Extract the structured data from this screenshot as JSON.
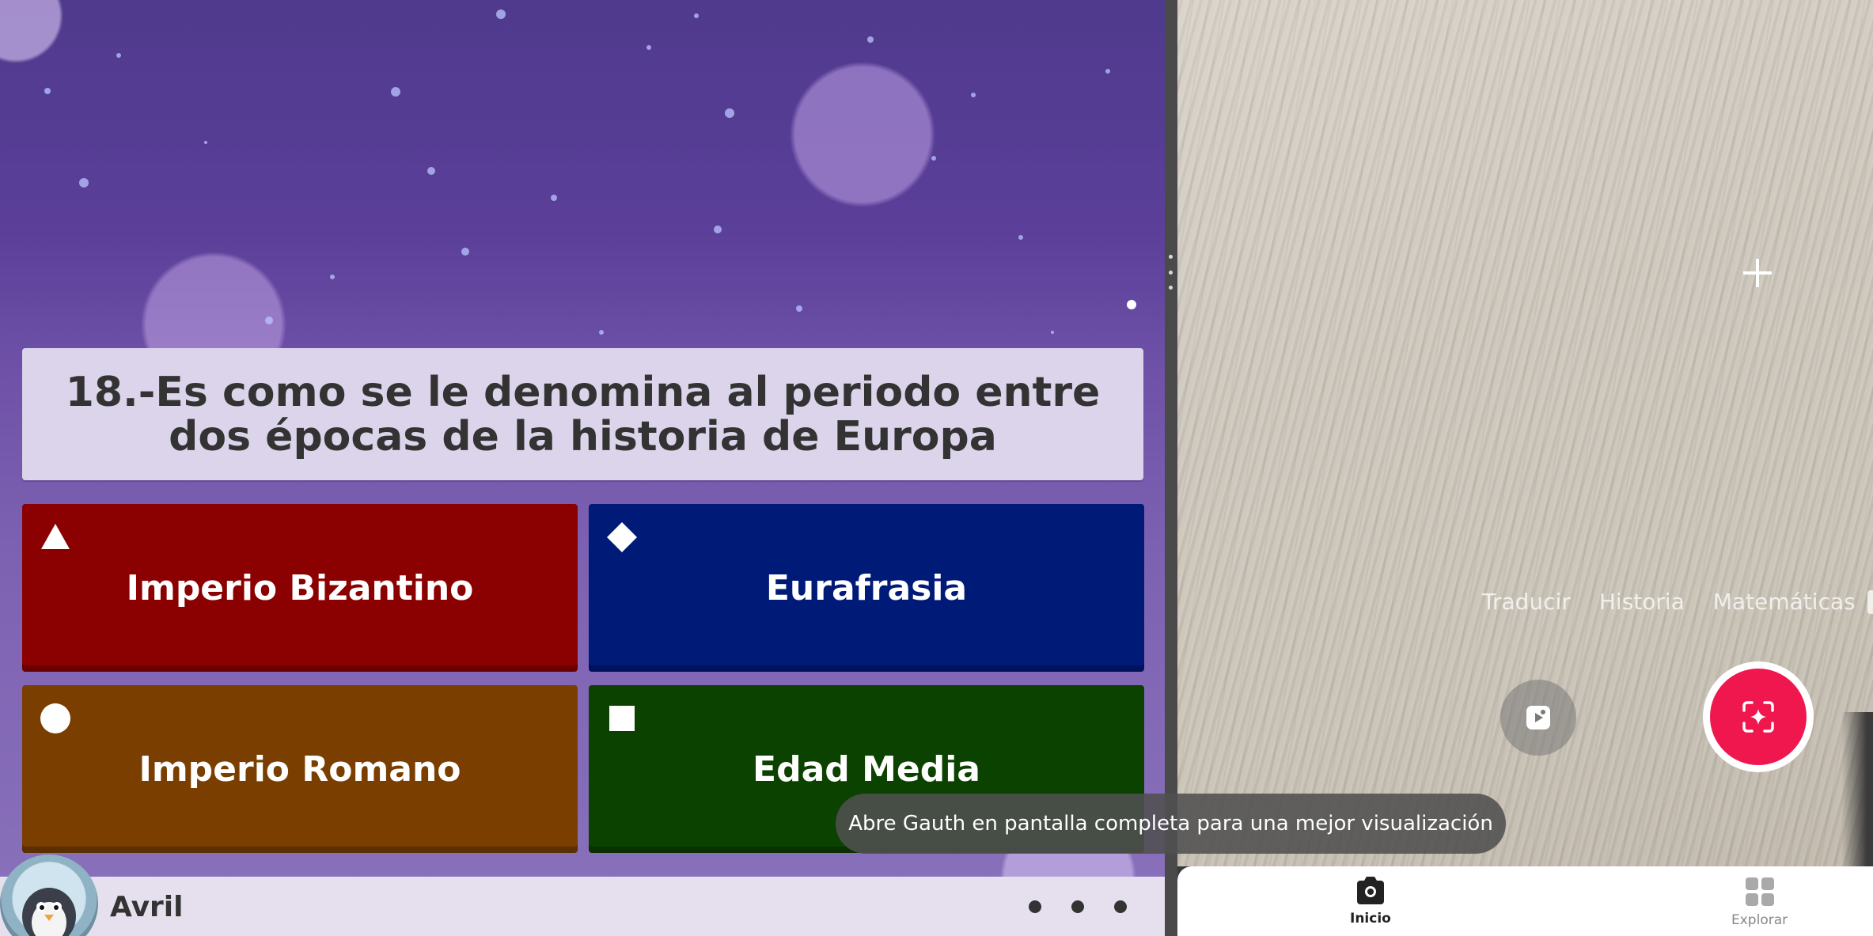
{
  "quiz": {
    "question": "18.-Es como se le denomina al periodo entre dos épocas de la historia de Europa",
    "answers": [
      {
        "label": "Imperio Bizantino",
        "shape": "triangle",
        "color": "#8b0000"
      },
      {
        "label": "Eurafrasia",
        "shape": "diamond",
        "color": "#001a78"
      },
      {
        "label": "Imperio Romano",
        "shape": "circle",
        "color": "#7a3f00"
      },
      {
        "label": "Edad Media",
        "shape": "square",
        "color": "#0c4200"
      }
    ],
    "player_name": "Avril",
    "menu_icon": "more-dots-icon"
  },
  "camera": {
    "modes": [
      "Traducir",
      "Historia",
      "Matemáticas"
    ],
    "shutter_color": "#f0174f",
    "toast": "Abre Gauth en pantalla completa para una mejor visualización"
  },
  "tabbar": {
    "home_label": "Inicio",
    "explore_label": "Explorar"
  }
}
